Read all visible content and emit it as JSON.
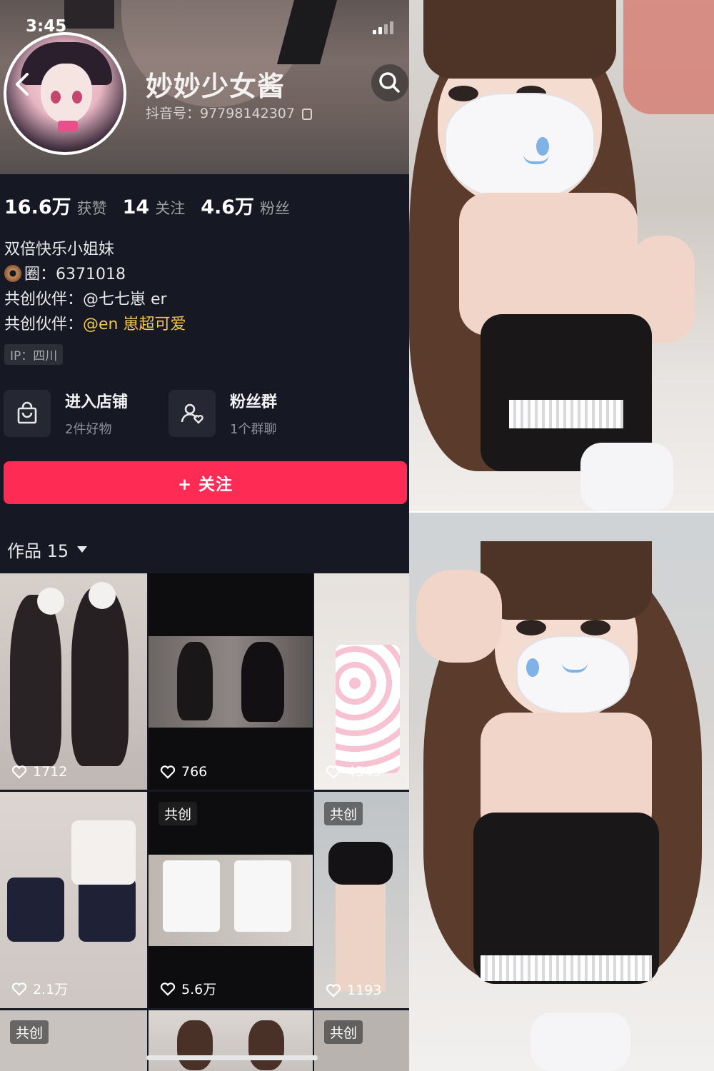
{
  "status_bar": {
    "time": "3:45"
  },
  "profile": {
    "nickname": "妙妙少女酱",
    "douyin_id": "抖音号：97798142307",
    "stats": [
      {
        "num": "16.6万",
        "label": "获赞"
      },
      {
        "num": "14",
        "label": "关注"
      },
      {
        "num": "4.6万",
        "label": "粉丝"
      }
    ],
    "bio": {
      "line1": "双倍快乐小姐妹",
      "line2": "圈：6371018",
      "line3": "共创伙伴：@七七崽 er",
      "line4_prefix": "共创伙伴：",
      "line4_mention": "@en 崽超可爱"
    },
    "ip": "IP：四川"
  },
  "cards": {
    "shop": {
      "title": "进入店铺",
      "sub": "2件好物"
    },
    "fans": {
      "title": "粉丝群",
      "sub": "1个群聊"
    }
  },
  "follow_button": "+ 关注",
  "works": {
    "header": "作品 15",
    "tiles": [
      {
        "likes": "1712",
        "co": ""
      },
      {
        "likes": "766",
        "co": ""
      },
      {
        "likes": "4349",
        "co": ""
      },
      {
        "likes": "2.1万",
        "co": ""
      },
      {
        "likes": "5.6万",
        "co": "共创"
      },
      {
        "likes": "1193",
        "co": "共创"
      },
      {
        "likes": "",
        "co": "共创"
      },
      {
        "likes": "",
        "co": ""
      },
      {
        "likes": "",
        "co": "共创"
      }
    ]
  },
  "colors": {
    "background": "#161823",
    "follow": "#fe2c55",
    "mention": "#f4c64a"
  },
  "icons": [
    "back-arrow-icon",
    "search-icon",
    "copy-icon",
    "shopping-bag-icon",
    "fan-group-icon",
    "heart-icon",
    "dropdown-caret-icon"
  ]
}
